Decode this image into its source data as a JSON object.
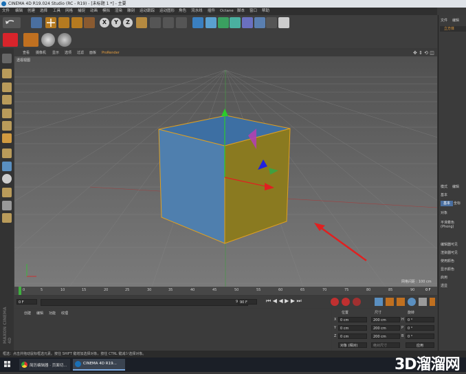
{
  "app_title": "CINEMA 4D R19.024 Studio (RC - R19) - [未标题 1 *] - 主要",
  "menu": [
    "文件",
    "编辑",
    "创建",
    "选择",
    "工具",
    "网格",
    "捕捉",
    "动画",
    "模拟",
    "渲染",
    "雕刻",
    "运动跟踪",
    "运动图形",
    "角色",
    "流水线",
    "插件",
    "Octane",
    "脚本",
    "窗口",
    "帮助"
  ],
  "toolbar": {
    "undo_icon": "undo-icon",
    "axis_buttons": [
      "X",
      "Y",
      "Z"
    ]
  },
  "viewport": {
    "menu": [
      "查看",
      "摄像机",
      "显示",
      "选项",
      "过滤",
      "面板",
      "ProRender"
    ],
    "view_label": "透视视图",
    "grid_spacing": "网格间距 : 100 cm"
  },
  "timeline": {
    "ticks": [
      "0",
      "5",
      "10",
      "15",
      "20",
      "25",
      "30",
      "35",
      "40",
      "45",
      "50",
      "55",
      "60",
      "65",
      "70",
      "75",
      "80",
      "85",
      "90"
    ],
    "current_frame": "0 F",
    "start_field": "0 F",
    "end_field": "90 F",
    "preview_max": "90 F"
  },
  "material_panel": {
    "menu": [
      "创建",
      "编辑",
      "功能",
      "纹理"
    ]
  },
  "coord_panel": {
    "headers": [
      "位置",
      "尺寸",
      "旋转"
    ],
    "rows": [
      {
        "axis": "X",
        "pos": "0 cm",
        "size": "200 cm",
        "rot_label": "H",
        "rot": "0 °"
      },
      {
        "axis": "Y",
        "pos": "0 cm",
        "size": "200 cm",
        "rot_label": "P",
        "rot": "0 °"
      },
      {
        "axis": "Z",
        "pos": "0 cm",
        "size": "200 cm",
        "rot_label": "B",
        "rot": "0 °"
      }
    ],
    "mode_select": "对象 (相对)",
    "size_select": "绝对尺寸",
    "apply_button": "应用"
  },
  "right_panel": {
    "tabs_top": [
      "文件",
      "编辑"
    ],
    "object_label": "立方体",
    "attr_tabs": [
      "模式",
      "编辑"
    ],
    "attr_title": "基本",
    "attr_items": [
      "基本",
      "坐标",
      "对象",
      "平滑着色(Phong)"
    ],
    "fields": [
      "编辑器可见",
      "渲染器可见",
      "使用颜色",
      "显示颜色",
      "启用",
      "透显"
    ]
  },
  "status_text": "框选：点击并拖动鼠标框选元素。按住 SHIFT 键增加选择对象，按住 CTRL 键减少选择对象。",
  "brand": {
    "maxon": "MAXON",
    "cinema": "CINEMA 4D"
  },
  "taskbar": {
    "items": [
      "简历编辑器 · 页面切...",
      "CINEMA 4D R19..."
    ],
    "watermark": "3D溜溜网"
  }
}
